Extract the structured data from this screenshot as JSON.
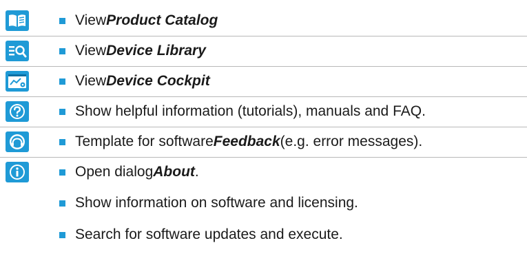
{
  "colors": {
    "accent": "#1f9ad6",
    "separator": "#b8b8b8"
  },
  "rows": [
    {
      "icon": "product-catalog-icon",
      "prefix": "View ",
      "emph": "Product Catalog",
      "suffix": ""
    },
    {
      "icon": "device-library-icon",
      "prefix": "View ",
      "emph": "Device Library",
      "suffix": ""
    },
    {
      "icon": "device-cockpit-icon",
      "prefix": "View ",
      "emph": "Device Cockpit",
      "suffix": ""
    },
    {
      "icon": "help-icon",
      "prefix": "Show helpful information (tutorials), manuals and FAQ.",
      "emph": "",
      "suffix": ""
    },
    {
      "icon": "feedback-icon",
      "prefix": "Template for software ",
      "emph": "Feedback",
      "suffix": "(e.g. error messages)."
    },
    {
      "icon": "info-icon",
      "prefix": "Open dialog ",
      "emph": "About",
      "suffix": "."
    }
  ],
  "about_subitems": [
    "Show information on software and licensing.",
    "Search for software updates and execute."
  ]
}
